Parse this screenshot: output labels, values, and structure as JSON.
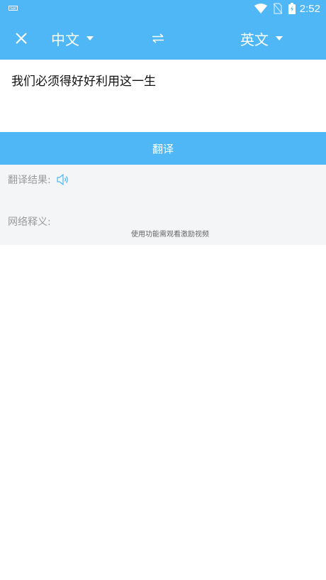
{
  "status_bar": {
    "time": "2:52",
    "icons": [
      "keyboard-icon",
      "wifi-icon",
      "no-sim-icon",
      "battery-charging-icon"
    ]
  },
  "toolbar": {
    "close_icon": "close-icon",
    "source_language": "中文",
    "swap_icon": "swap-icon",
    "target_language": "英文"
  },
  "input": {
    "text": "我们必须得好好利用这一生"
  },
  "translate_button": {
    "label": "翻译"
  },
  "result": {
    "label": "翻译结果:",
    "speaker_icon": "speaker-icon",
    "web_definition_label": "网络释义:",
    "video_hint": "使用功能需观看激励视频"
  },
  "colors": {
    "primary": "#4fb7f6",
    "result_bg": "#f4f5f7",
    "muted_text": "#9a9a9a"
  }
}
